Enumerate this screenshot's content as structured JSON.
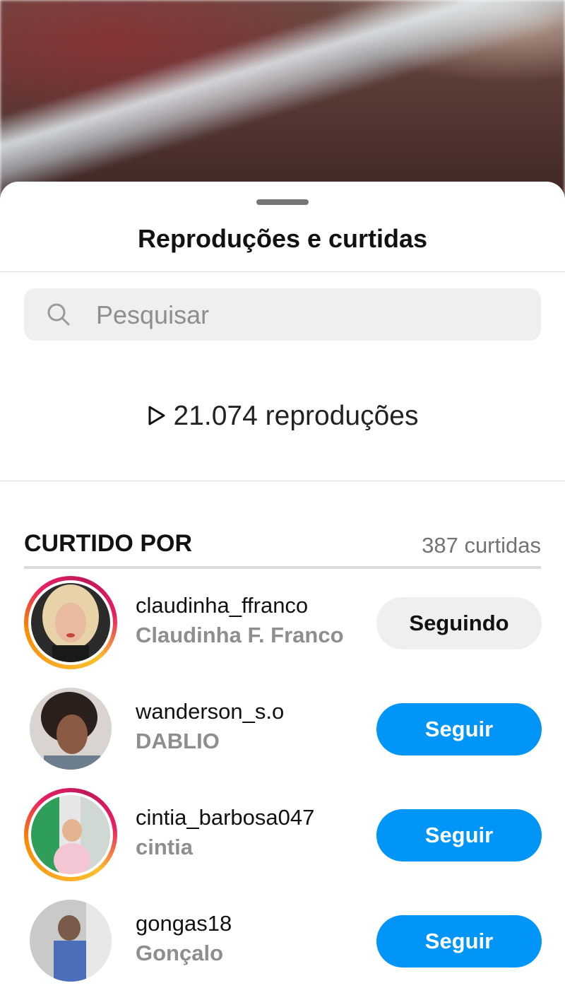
{
  "sheet": {
    "title": "Reproduções e curtidas"
  },
  "search": {
    "placeholder": "Pesquisar"
  },
  "plays": {
    "text": "21.074 reproduções"
  },
  "liked_by": {
    "header": "CURTIDO POR",
    "count": "387 curtidas"
  },
  "users": [
    {
      "username": "claudinha_ffranco",
      "full_name": "Claudinha F. Franco",
      "button": "Seguindo",
      "following": true,
      "has_story": true
    },
    {
      "username": "wanderson_s.o",
      "full_name": "DABLIO",
      "button": "Seguir",
      "following": false,
      "has_story": false
    },
    {
      "username": "cintia_barbosa047",
      "full_name": "cintia",
      "button": "Seguir",
      "following": false,
      "has_story": true
    },
    {
      "username": "gongas18",
      "full_name": "Gonçalo",
      "button": "Seguir",
      "following": false,
      "has_story": false
    }
  ],
  "colors": {
    "follow_blue": "#0095f6",
    "following_gray": "#efefef",
    "secondary_text": "#8e8e8e"
  }
}
